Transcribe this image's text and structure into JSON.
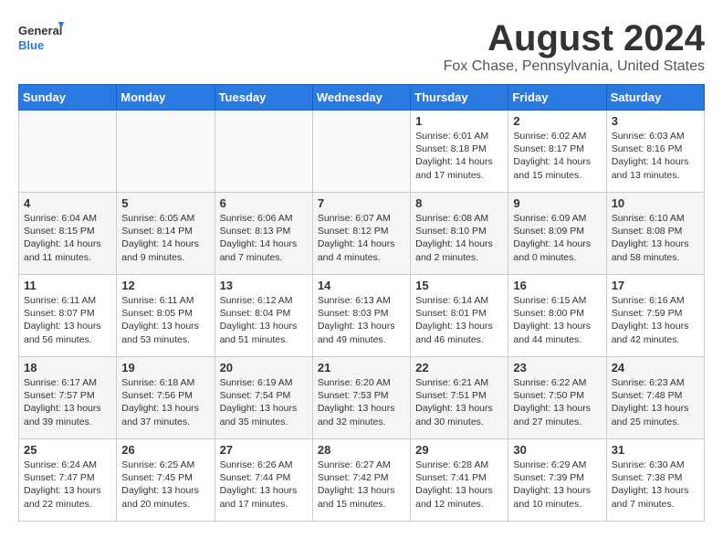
{
  "logo": {
    "line1": "General",
    "line2": "Blue"
  },
  "title": "August 2024",
  "subtitle": "Fox Chase, Pennsylvania, United States",
  "days_of_week": [
    "Sunday",
    "Monday",
    "Tuesday",
    "Wednesday",
    "Thursday",
    "Friday",
    "Saturday"
  ],
  "weeks": [
    [
      {
        "num": "",
        "detail": ""
      },
      {
        "num": "",
        "detail": ""
      },
      {
        "num": "",
        "detail": ""
      },
      {
        "num": "",
        "detail": ""
      },
      {
        "num": "1",
        "detail": "Sunrise: 6:01 AM\nSunset: 8:18 PM\nDaylight: 14 hours\nand 17 minutes."
      },
      {
        "num": "2",
        "detail": "Sunrise: 6:02 AM\nSunset: 8:17 PM\nDaylight: 14 hours\nand 15 minutes."
      },
      {
        "num": "3",
        "detail": "Sunrise: 6:03 AM\nSunset: 8:16 PM\nDaylight: 14 hours\nand 13 minutes."
      }
    ],
    [
      {
        "num": "4",
        "detail": "Sunrise: 6:04 AM\nSunset: 8:15 PM\nDaylight: 14 hours\nand 11 minutes."
      },
      {
        "num": "5",
        "detail": "Sunrise: 6:05 AM\nSunset: 8:14 PM\nDaylight: 14 hours\nand 9 minutes."
      },
      {
        "num": "6",
        "detail": "Sunrise: 6:06 AM\nSunset: 8:13 PM\nDaylight: 14 hours\nand 7 minutes."
      },
      {
        "num": "7",
        "detail": "Sunrise: 6:07 AM\nSunset: 8:12 PM\nDaylight: 14 hours\nand 4 minutes."
      },
      {
        "num": "8",
        "detail": "Sunrise: 6:08 AM\nSunset: 8:10 PM\nDaylight: 14 hours\nand 2 minutes."
      },
      {
        "num": "9",
        "detail": "Sunrise: 6:09 AM\nSunset: 8:09 PM\nDaylight: 14 hours\nand 0 minutes."
      },
      {
        "num": "10",
        "detail": "Sunrise: 6:10 AM\nSunset: 8:08 PM\nDaylight: 13 hours\nand 58 minutes."
      }
    ],
    [
      {
        "num": "11",
        "detail": "Sunrise: 6:11 AM\nSunset: 8:07 PM\nDaylight: 13 hours\nand 56 minutes."
      },
      {
        "num": "12",
        "detail": "Sunrise: 6:11 AM\nSunset: 8:05 PM\nDaylight: 13 hours\nand 53 minutes."
      },
      {
        "num": "13",
        "detail": "Sunrise: 6:12 AM\nSunset: 8:04 PM\nDaylight: 13 hours\nand 51 minutes."
      },
      {
        "num": "14",
        "detail": "Sunrise: 6:13 AM\nSunset: 8:03 PM\nDaylight: 13 hours\nand 49 minutes."
      },
      {
        "num": "15",
        "detail": "Sunrise: 6:14 AM\nSunset: 8:01 PM\nDaylight: 13 hours\nand 46 minutes."
      },
      {
        "num": "16",
        "detail": "Sunrise: 6:15 AM\nSunset: 8:00 PM\nDaylight: 13 hours\nand 44 minutes."
      },
      {
        "num": "17",
        "detail": "Sunrise: 6:16 AM\nSunset: 7:59 PM\nDaylight: 13 hours\nand 42 minutes."
      }
    ],
    [
      {
        "num": "18",
        "detail": "Sunrise: 6:17 AM\nSunset: 7:57 PM\nDaylight: 13 hours\nand 39 minutes."
      },
      {
        "num": "19",
        "detail": "Sunrise: 6:18 AM\nSunset: 7:56 PM\nDaylight: 13 hours\nand 37 minutes."
      },
      {
        "num": "20",
        "detail": "Sunrise: 6:19 AM\nSunset: 7:54 PM\nDaylight: 13 hours\nand 35 minutes."
      },
      {
        "num": "21",
        "detail": "Sunrise: 6:20 AM\nSunset: 7:53 PM\nDaylight: 13 hours\nand 32 minutes."
      },
      {
        "num": "22",
        "detail": "Sunrise: 6:21 AM\nSunset: 7:51 PM\nDaylight: 13 hours\nand 30 minutes."
      },
      {
        "num": "23",
        "detail": "Sunrise: 6:22 AM\nSunset: 7:50 PM\nDaylight: 13 hours\nand 27 minutes."
      },
      {
        "num": "24",
        "detail": "Sunrise: 6:23 AM\nSunset: 7:48 PM\nDaylight: 13 hours\nand 25 minutes."
      }
    ],
    [
      {
        "num": "25",
        "detail": "Sunrise: 6:24 AM\nSunset: 7:47 PM\nDaylight: 13 hours\nand 22 minutes."
      },
      {
        "num": "26",
        "detail": "Sunrise: 6:25 AM\nSunset: 7:45 PM\nDaylight: 13 hours\nand 20 minutes."
      },
      {
        "num": "27",
        "detail": "Sunrise: 6:26 AM\nSunset: 7:44 PM\nDaylight: 13 hours\nand 17 minutes."
      },
      {
        "num": "28",
        "detail": "Sunrise: 6:27 AM\nSunset: 7:42 PM\nDaylight: 13 hours\nand 15 minutes."
      },
      {
        "num": "29",
        "detail": "Sunrise: 6:28 AM\nSunset: 7:41 PM\nDaylight: 13 hours\nand 12 minutes."
      },
      {
        "num": "30",
        "detail": "Sunrise: 6:29 AM\nSunset: 7:39 PM\nDaylight: 13 hours\nand 10 minutes."
      },
      {
        "num": "31",
        "detail": "Sunrise: 6:30 AM\nSunset: 7:38 PM\nDaylight: 13 hours\nand 7 minutes."
      }
    ]
  ]
}
